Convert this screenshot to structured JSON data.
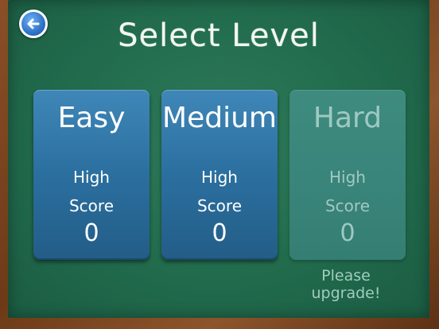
{
  "screen": {
    "title": "Select Level",
    "back_icon": "back-arrow-icon",
    "colors": {
      "chalkboard": "#236e4f",
      "frame": "#7a4320",
      "card_active": "#2b6f9f",
      "card_locked": "#3a857b",
      "back_button": "#2f73c9"
    }
  },
  "levels": [
    {
      "name": "Easy",
      "high_score_label": "High\nScore",
      "high_score": "0",
      "locked": false
    },
    {
      "name": "Medium",
      "high_score_label": "High\nScore",
      "high_score": "0",
      "locked": false
    },
    {
      "name": "Hard",
      "high_score_label": "High\nScore",
      "high_score": "0",
      "locked": true
    }
  ],
  "upgrade_message": "Please upgrade!"
}
